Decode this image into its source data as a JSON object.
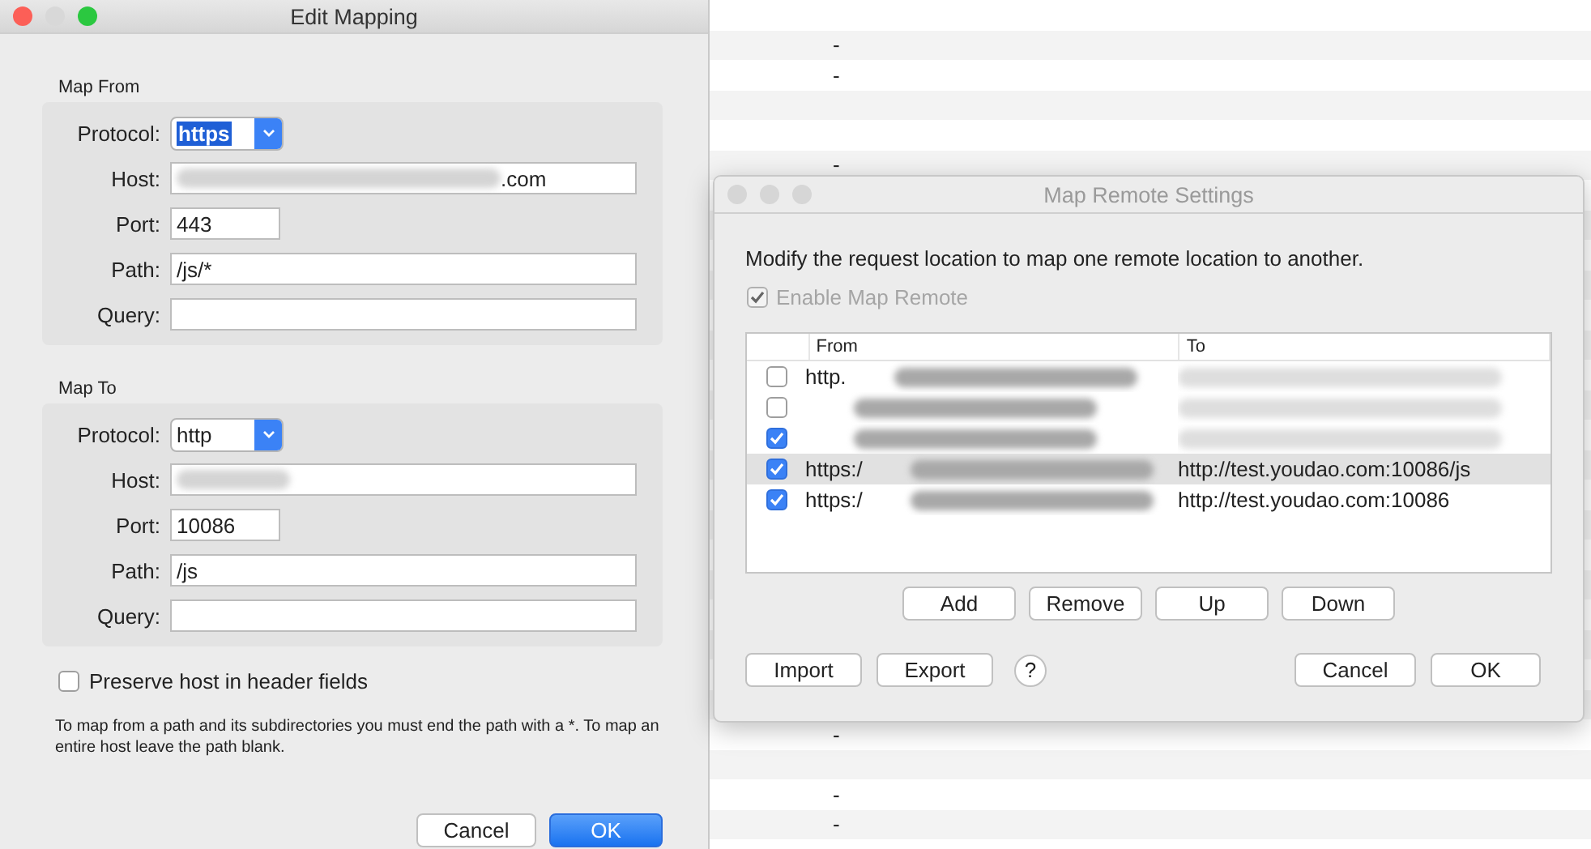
{
  "background": {
    "rows": [
      {
        "kind": "empty"
      },
      {
        "kind": "dash",
        "text": "-"
      },
      {
        "kind": "dash",
        "text": "-"
      },
      {
        "kind": "empty"
      },
      {
        "kind": "empty"
      },
      {
        "kind": "dash",
        "text": "-"
      },
      {
        "kind": "empty"
      },
      {
        "kind": "empty"
      },
      {
        "kind": "empty"
      },
      {
        "kind": "empty"
      },
      {
        "kind": "empty"
      },
      {
        "kind": "empty"
      },
      {
        "kind": "empty"
      },
      {
        "kind": "empty"
      },
      {
        "kind": "empty"
      },
      {
        "kind": "empty"
      },
      {
        "kind": "empty"
      },
      {
        "kind": "empty"
      },
      {
        "kind": "empty"
      },
      {
        "kind": "empty"
      },
      {
        "kind": "empty"
      },
      {
        "kind": "empty"
      },
      {
        "kind": "empty"
      },
      {
        "kind": "empty"
      },
      {
        "kind": "dash",
        "text": "-"
      },
      {
        "kind": "empty"
      },
      {
        "kind": "dash",
        "text": "-"
      },
      {
        "kind": "dash",
        "text": "-"
      }
    ]
  },
  "edit_mapping": {
    "title": "Edit Mapping",
    "map_from": {
      "label": "Map From",
      "protocol": {
        "label": "Protocol:",
        "value": "https",
        "highlighted": true
      },
      "fields": [
        {
          "label": "Host:",
          "value": ".com",
          "redacted": true
        },
        {
          "label": "Port:",
          "value": "443",
          "short": true
        },
        {
          "label": "Path:",
          "value": "/js/*"
        },
        {
          "label": "Query:"
        }
      ]
    },
    "map_to": {
      "label": "Map To",
      "protocol": {
        "label": "Protocol:",
        "value": "http",
        "highlighted": false
      },
      "fields": [
        {
          "label": "Host:",
          "redacted": true
        },
        {
          "label": "Port:",
          "value": "10086",
          "short": true
        },
        {
          "label": "Path:",
          "value": "/js"
        },
        {
          "label": "Query:"
        }
      ]
    },
    "preserve_host": {
      "label": "Preserve host in header fields",
      "checked": false
    },
    "note": "To map from a path and its subdirectories you must end the path with a *. To map an entire host leave the path blank.",
    "buttons": [
      {
        "label": "Cancel",
        "kind": "normal"
      },
      {
        "label": "OK",
        "kind": "default"
      }
    ]
  },
  "map_remote": {
    "title": "Map Remote Settings",
    "description": "Modify the request location to map one remote location to another.",
    "enable": {
      "label": "Enable Map Remote",
      "checked": true,
      "disabled": true
    },
    "columns": [
      "From",
      "To"
    ],
    "rows": [
      {
        "checked": false,
        "selected": false,
        "from": "http."
      },
      {
        "checked": false,
        "selected": false
      },
      {
        "checked": true,
        "selected": false
      },
      {
        "checked": true,
        "selected": true,
        "from": "https:/",
        "to": "http://test.youdao.com:10086/js"
      },
      {
        "checked": true,
        "selected": false,
        "from": "https:/",
        "to": "http://test.youdao.com:10086"
      }
    ],
    "list_buttons": [
      "Add",
      "Remove",
      "Up",
      "Down"
    ],
    "left_buttons": [
      "Import",
      "Export"
    ],
    "help": "?",
    "right_buttons": [
      "Cancel",
      "OK"
    ]
  }
}
